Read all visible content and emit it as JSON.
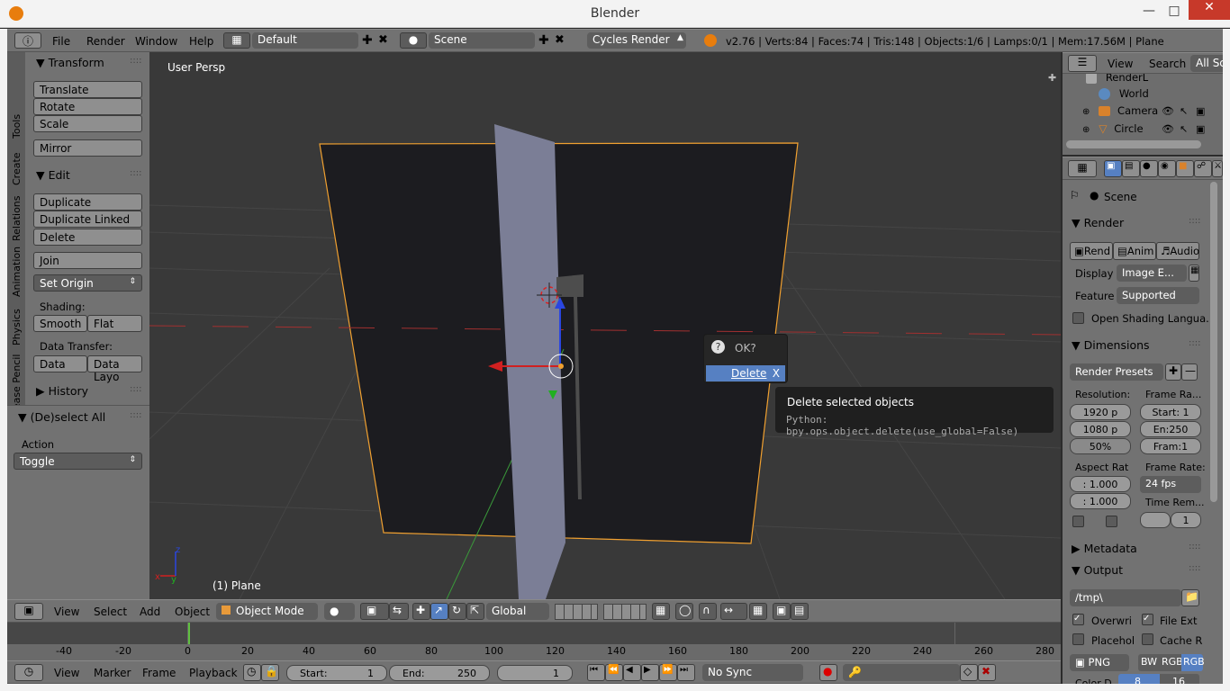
{
  "window": {
    "title": "Blender"
  },
  "topbar": {
    "menus": [
      "File",
      "Render",
      "Window",
      "Help"
    ],
    "screen_layout": "Default",
    "scene": "Scene",
    "engine": "Cycles Render",
    "stats": "v2.76 | Verts:84 | Faces:74 | Tris:148 | Objects:1/6 | Lamps:0/1 | Mem:17.56M | Plane"
  },
  "toolshelf": {
    "tabs": [
      "Tools",
      "Create",
      "Relations",
      "Animation",
      "Physics",
      "Grease Pencil"
    ],
    "transform": {
      "title": "Transform",
      "buttons": [
        "Translate",
        "Rotate",
        "Scale",
        "Mirror"
      ]
    },
    "edit": {
      "title": "Edit",
      "buttons": [
        "Duplicate",
        "Duplicate Linked",
        "Delete",
        "Join"
      ],
      "set_origin": "Set Origin"
    },
    "shading": {
      "label": "Shading:",
      "smooth": "Smooth",
      "flat": "Flat"
    },
    "data_transfer": {
      "label": "Data Transfer:",
      "data": "Data",
      "data_layout": "Data Layo"
    },
    "history": "History"
  },
  "operator": {
    "title": "(De)select All",
    "action_label": "Action",
    "action_value": "Toggle"
  },
  "viewport": {
    "label": "User Persp",
    "object_label": "(1) Plane"
  },
  "popup": {
    "question": "OK?",
    "delete": "Delete",
    "shortcut": "X"
  },
  "tooltip": {
    "title": "Delete selected objects",
    "python": "Python: bpy.ops.object.delete(use_global=False)"
  },
  "view3d_header": {
    "menus": [
      "View",
      "Select",
      "Add",
      "Object"
    ],
    "mode": "Object Mode",
    "orientation": "Global"
  },
  "timeline": {
    "ticks": [
      "-40",
      "-20",
      "0",
      "20",
      "40",
      "60",
      "80",
      "100",
      "120",
      "140",
      "160",
      "180",
      "200",
      "220",
      "240",
      "260",
      "280"
    ],
    "menus": [
      "View",
      "Marker",
      "Frame",
      "Playback"
    ],
    "start_label": "Start:",
    "start_value": "1",
    "end_label": "End:",
    "end_value": "250",
    "current_frame": "1",
    "sync": "No Sync"
  },
  "outliner": {
    "menus": [
      "View",
      "Search"
    ],
    "filter": "All Sc",
    "items": [
      "RenderL",
      "World",
      "Camera",
      "Circle"
    ]
  },
  "properties": {
    "context": "Scene",
    "render": {
      "title": "Render",
      "buttons": [
        "Rend",
        "Anim",
        "Audio"
      ],
      "display_label": "Display",
      "display_value": "Image E...",
      "feature_label": "Feature",
      "feature_value": "Supported",
      "osl": "Open Shading Langua..."
    },
    "dimensions": {
      "title": "Dimensions",
      "presets": "Render Presets",
      "resolution_label": "Resolution:",
      "res_x": "1920 p",
      "res_y": "1080 p",
      "res_pct": "50%",
      "frame_range_label": "Frame Ra...",
      "start": "Start: 1",
      "end": "En:250",
      "step": "Fram:1",
      "aspect_label": "Aspect Rat",
      "aspect_x": ": 1.000",
      "aspect_y": ": 1.000",
      "frame_rate_label": "Frame Rate:",
      "fps": "24 fps",
      "time_remap_label": "Time Rem...",
      "time_remap_value": "1"
    },
    "metadata": "Metadata",
    "output": {
      "title": "Output",
      "path": "/tmp\\",
      "overwrite": "Overwri",
      "file_ext": "File Ext",
      "placeholder": "Placehol",
      "cache": "Cache R",
      "format": "PNG",
      "bw": "BW",
      "rgb": "RGB",
      "rgba": "RGB",
      "color_depth_label": "Color D",
      "depth_8": "8",
      "depth_16": "16"
    }
  },
  "colors": {
    "accent": "#5680c2",
    "selection": "#f0a030",
    "background": "#393939"
  }
}
